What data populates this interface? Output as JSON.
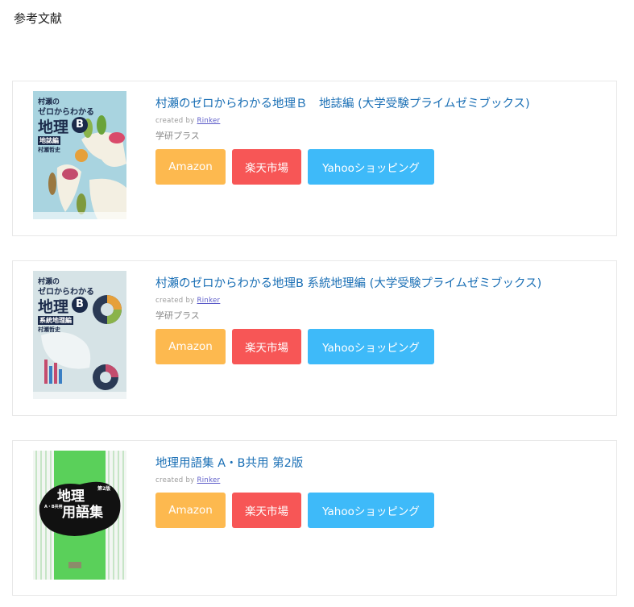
{
  "page": {
    "heading": "参考文献"
  },
  "colors": {
    "amazon": "#fdb94f",
    "rakuten": "#f75656",
    "yahoo": "#3ebaf9",
    "title_link": "#1a6fb5"
  },
  "books": [
    {
      "title": "村瀬のゼロからわかる地理Ｂ　地誌編 (大学受験プライムゼミブックス)",
      "created_prefix": "created by",
      "created_link": "Rinker",
      "publisher": "学研プラス",
      "buttons": {
        "amazon": "Amazon",
        "rakuten": "楽天市場",
        "yahoo": "Yahooショッピング"
      },
      "cover": {
        "line1": "村瀬の",
        "line2": "ゼロからわかる",
        "line3": "地理",
        "badge": "B",
        "sub": "地誌編",
        "author": "村瀬哲史"
      }
    },
    {
      "title": "村瀬のゼロからわかる地理B 系統地理編 (大学受験プライムゼミブックス)",
      "created_prefix": "created by",
      "created_link": "Rinker",
      "publisher": "学研プラス",
      "buttons": {
        "amazon": "Amazon",
        "rakuten": "楽天市場",
        "yahoo": "Yahooショッピング"
      },
      "cover": {
        "line1": "村瀬の",
        "line2": "ゼロからわかる",
        "line3": "地理",
        "badge": "B",
        "sub": "系統地理編",
        "author": "村瀬哲史"
      }
    },
    {
      "title": "地理用語集 A・B共用 第2版",
      "created_prefix": "created by",
      "created_link": "Rinker",
      "buttons": {
        "amazon": "Amazon",
        "rakuten": "楽天市場",
        "yahoo": "Yahooショッピング"
      },
      "cover": {
        "line1": "地理",
        "line2": "用語集",
        "edition": "第2版",
        "side": "A・B共用"
      }
    }
  ]
}
